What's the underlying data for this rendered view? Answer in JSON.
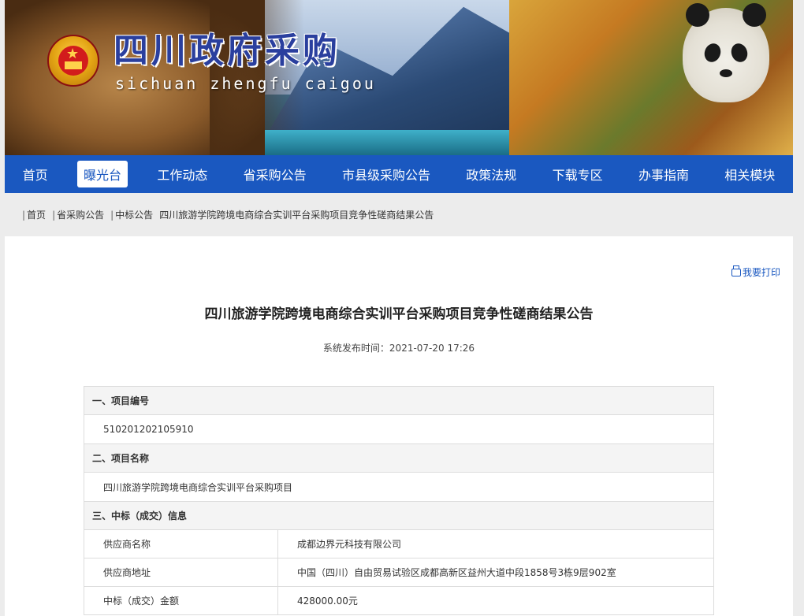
{
  "header": {
    "site_title": "四川政府采购",
    "site_subtitle": "sichuan zhengfu caigou"
  },
  "nav": {
    "items": [
      {
        "label": "首页"
      },
      {
        "label": "曝光台"
      },
      {
        "label": "工作动态"
      },
      {
        "label": "省采购公告"
      },
      {
        "label": "市县级采购公告"
      },
      {
        "label": "政策法规"
      },
      {
        "label": "下载专区"
      },
      {
        "label": "办事指南"
      },
      {
        "label": "相关模块"
      }
    ],
    "active": "曝光台"
  },
  "breadcrumb": {
    "items": [
      "首页",
      "省采购公告",
      "中标公告"
    ],
    "current": "四川旅游学院跨境电商综合实训平台采购项目竞争性磋商结果公告"
  },
  "print_label": "我要打印",
  "article": {
    "title": "四川旅游学院跨境电商综合实训平台采购项目竞争性磋商结果公告",
    "publish_time": "系统发布时间：2021-07-20 17:26"
  },
  "details": {
    "sec1_title": "一、项目编号",
    "project_number": "510201202105910",
    "sec2_title": "二、项目名称",
    "project_name": "四川旅游学院跨境电商综合实训平台采购项目",
    "sec3_title": "三、中标（成交）信息",
    "rows": [
      {
        "k": "供应商名称",
        "v": "成都边界元科技有限公司"
      },
      {
        "k": "供应商地址",
        "v": "中国（四川）自由贸易试验区成都高新区益州大道中段1858号3栋9层902室"
      },
      {
        "k": "中标（成交）金额",
        "v": "428000.00元"
      }
    ]
  },
  "colors": {
    "nav_blue": "#1a58c0",
    "title_blue": "#2a3f9e"
  }
}
